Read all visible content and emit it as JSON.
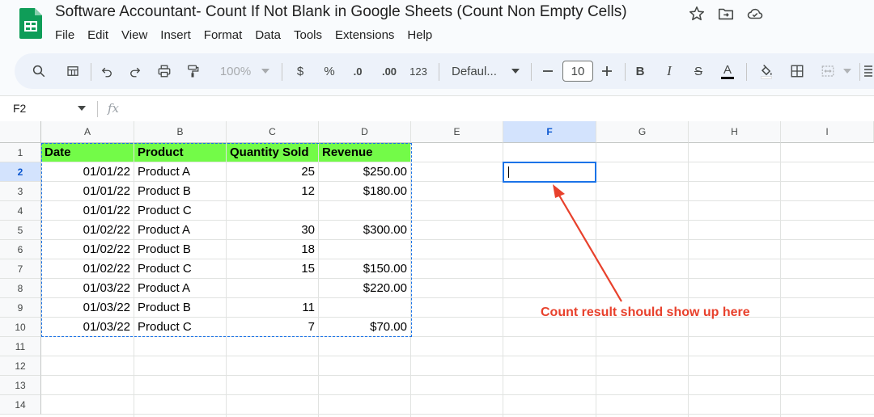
{
  "app": {
    "doc_title": "Software Accountant- Count If Not Blank in Google Sheets (Count Non Empty Cells)",
    "title_icons": [
      "star-icon",
      "move-to-folder-icon",
      "cloud-status-icon"
    ],
    "menu": [
      "File",
      "Edit",
      "View",
      "Insert",
      "Format",
      "Data",
      "Tools",
      "Extensions",
      "Help"
    ]
  },
  "toolbar": {
    "zoom": "100%",
    "currency": "$",
    "percent": "%",
    "decrease_decimal": ".0",
    "increase_decimal": ".00",
    "number_format": "123",
    "font": "Defaul...",
    "font_size": "10",
    "bold": "B",
    "italic": "I",
    "strike": "S",
    "text_color": "A"
  },
  "formula_bar": {
    "cell_ref": "F2",
    "fx": "fx",
    "value": ""
  },
  "sheet": {
    "columns": [
      "A",
      "B",
      "C",
      "D",
      "E",
      "F",
      "G",
      "H",
      "I"
    ],
    "rows": [
      "1",
      "2",
      "3",
      "4",
      "5",
      "6",
      "7",
      "8",
      "9",
      "10",
      "11",
      "12",
      "13",
      "14"
    ],
    "selected_cell": "F2",
    "header_fill": "#73fb48",
    "table_headers": [
      "Date",
      "Product",
      "Quantity Sold",
      "Revenue"
    ],
    "table_rows": [
      [
        "01/01/22",
        "Product A",
        "25",
        "$250.00"
      ],
      [
        "01/01/22",
        "Product B",
        "12",
        "$180.00"
      ],
      [
        "01/01/22",
        "Product C",
        "",
        ""
      ],
      [
        "01/02/22",
        "Product A",
        "30",
        "$300.00"
      ],
      [
        "01/02/22",
        "Product B",
        "18",
        ""
      ],
      [
        "01/02/22",
        "Product C",
        "15",
        "$150.00"
      ],
      [
        "01/03/22",
        "Product A",
        "",
        "$220.00"
      ],
      [
        "01/03/22",
        "Product B",
        "11",
        ""
      ],
      [
        "01/03/22",
        "Product C",
        "7",
        "$70.00"
      ]
    ]
  },
  "annotation": {
    "text": "Count result should show up here",
    "color": "#e8412c"
  }
}
